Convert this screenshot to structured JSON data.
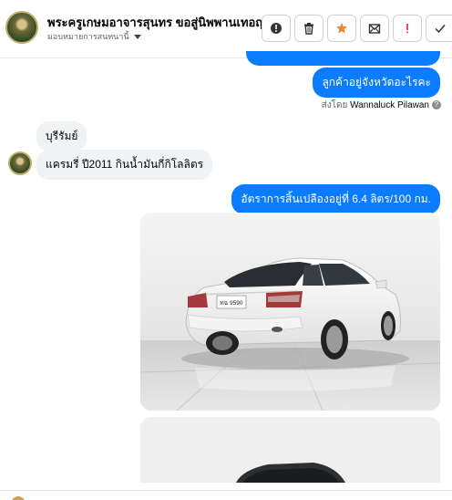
{
  "header": {
    "title": "พระครูเกษมอาจารสุนทร ขอสู่นิพพานเทอญ",
    "assignment": "มอบหมายการสนทนานี้",
    "tools": [
      {
        "name": "report-icon",
        "color": "#606770"
      },
      {
        "name": "trash-icon",
        "color": "#606770"
      },
      {
        "name": "star-icon",
        "color": "#e4893a"
      },
      {
        "name": "mail-icon",
        "color": "#606770"
      },
      {
        "name": "exclamation-icon",
        "color": "#e41e3f"
      },
      {
        "name": "check-icon",
        "color": "#606770"
      }
    ]
  },
  "messages": {
    "out_1": "ลูกค้าอยู่จังหวัดอะไรคะ",
    "sent_by_prefix": "ส่งโดย",
    "sent_by_name": "Wannaluck Pilawan",
    "help_glyph": "?",
    "in_1": "บุรีรัมย์",
    "in_2": "แครมรี่ ปี2011 กินน้ำมันกี่กิโลลิตร",
    "out_2": "อัตราการสิ้นเปลืองอยู่ที่ 6.4 ลิตร/100 กม."
  },
  "photo": {
    "plate_text": "ทฉ 9590"
  },
  "colors": {
    "outgoing": "#0a7cff",
    "incoming": "#f0f2f5",
    "secondary_text": "#65676b"
  }
}
